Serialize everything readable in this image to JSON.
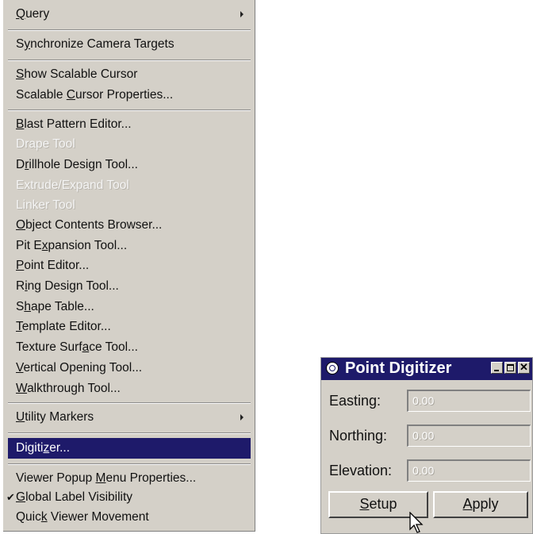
{
  "menu": {
    "items": [
      {
        "label": "Query",
        "ul": "Q",
        "disabled": false,
        "submenu": true
      },
      {
        "label": "Synchronize Camera Targets",
        "ul": "y",
        "disabled": false
      },
      {
        "label": "Show Scalable Cursor",
        "ul": "S",
        "disabled": false
      },
      {
        "label": "Scalable Cursor Properties...",
        "ul": "C",
        "disabled": false
      },
      {
        "label": "Blast Pattern Editor...",
        "ul": "B",
        "disabled": false
      },
      {
        "label": "Drape Tool",
        "disabled": true
      },
      {
        "label": "Drillhole Design Tool...",
        "ul": "r",
        "disabled": false
      },
      {
        "label": "Extrude/Expand Tool",
        "disabled": true
      },
      {
        "label": "Linker Tool",
        "disabled": true
      },
      {
        "label": "Object Contents Browser...",
        "ul": "O",
        "disabled": false
      },
      {
        "label": "Pit Expansion Tool...",
        "ul": "x",
        "disabled": false
      },
      {
        "label": "Point Editor...",
        "ul": "P",
        "disabled": false
      },
      {
        "label": "Ring Design Tool...",
        "ul": "i",
        "disabled": false
      },
      {
        "label": "Shape Table...",
        "ul": "h",
        "disabled": false
      },
      {
        "label": "Template Editor...",
        "ul": "T",
        "disabled": false
      },
      {
        "label": "Texture Surface Tool...",
        "ul": "a",
        "disabled": false
      },
      {
        "label": "Vertical Opening Tool...",
        "ul": "V",
        "disabled": false
      },
      {
        "label": "Walkthrough Tool...",
        "ul": "W",
        "disabled": false
      },
      {
        "label": "Utility Markers",
        "ul": "U",
        "disabled": false,
        "submenu": true
      },
      {
        "label": "Digitizer...",
        "ul": "z",
        "disabled": false,
        "highlighted": true
      },
      {
        "label": "Viewer Popup Menu Properties...",
        "ul": "M",
        "disabled": false
      },
      {
        "label": "Global Label Visibility",
        "ul": "G",
        "disabled": false,
        "checked": true
      },
      {
        "label": "Quick Viewer Movement",
        "ul": "k",
        "disabled": false
      }
    ]
  },
  "dialog": {
    "title": "Point Digitizer",
    "fields": [
      {
        "label": "Easting:",
        "value": "0.00"
      },
      {
        "label": "Northing:",
        "value": "0.00"
      },
      {
        "label": "Elevation:",
        "value": "0.00"
      }
    ],
    "setup_label": "Setup",
    "apply_label": "Apply",
    "close_glyph": "✕"
  },
  "colors": {
    "menu_bg": "#d4d0c8",
    "highlight": "#1e1a6a",
    "titlebar": "#1e1a6a"
  },
  "icons": {
    "title_icon": "globe-icon",
    "submenu_arrow": "chevron-right-icon",
    "check": "check-icon",
    "cursor": "mouse-pointer-icon"
  }
}
